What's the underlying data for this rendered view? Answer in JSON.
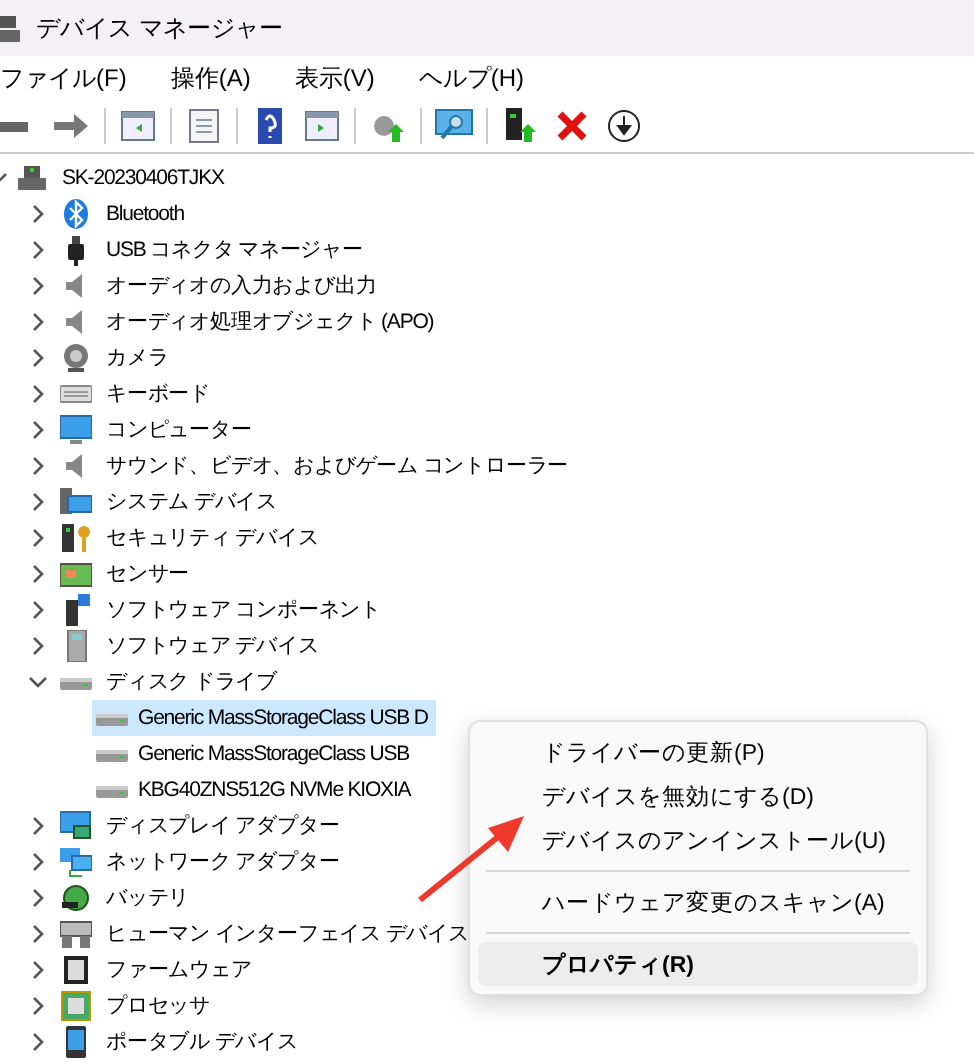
{
  "window": {
    "title": "デバイス マネージャー"
  },
  "menu_bar": [
    "ファイル(F)",
    "操作(A)",
    "表示(V)",
    "ヘルプ(H)"
  ],
  "tree": [
    {
      "label": "SK-20230406TJKX",
      "expanded": true,
      "children": [
        {
          "label": "Bluetooth",
          "expanded": false
        },
        {
          "label": "USB コネクタ マネージャー",
          "expanded": false
        },
        {
          "label": "オーディオの入力および出力",
          "expanded": false
        },
        {
          "label": "オーディオ処理オブジェクト (APO)",
          "expanded": false
        },
        {
          "label": "カメラ",
          "expanded": false
        },
        {
          "label": "キーボード",
          "expanded": false
        },
        {
          "label": "コンピューター",
          "expanded": false
        },
        {
          "label": "サウンド、ビデオ、およびゲーム コントローラー",
          "expanded": false
        },
        {
          "label": "システム デバイス",
          "expanded": false
        },
        {
          "label": "セキュリティ デバイス",
          "expanded": false
        },
        {
          "label": "センサー",
          "expanded": false
        },
        {
          "label": "ソフトウェア コンポーネント",
          "expanded": false
        },
        {
          "label": "ソフトウェア デバイス",
          "expanded": false
        },
        {
          "label": "ディスク ドライブ",
          "expanded": true,
          "children": [
            {
              "label": "Generic MassStorageClass USB D",
              "selected": true
            },
            {
              "label": "Generic MassStorageClass USB",
              "selected": false
            },
            {
              "label": "KBG40ZNS512G NVMe KIOXIA",
              "selected": false
            }
          ]
        },
        {
          "label": "ディスプレイ アダプター",
          "expanded": false
        },
        {
          "label": "ネットワーク アダプター",
          "expanded": false
        },
        {
          "label": "バッテリ",
          "expanded": false
        },
        {
          "label": "ヒューマン インターフェイス デバイス",
          "expanded": false
        },
        {
          "label": "ファームウェア",
          "expanded": false
        },
        {
          "label": "プロセッサ",
          "expanded": false
        },
        {
          "label": "ポータブル デバイス",
          "expanded": false
        }
      ]
    }
  ],
  "context_menu": [
    {
      "kind": "item",
      "label": "ドライバーの更新(P)",
      "selected": false,
      "bold": false
    },
    {
      "kind": "item",
      "label": "デバイスを無効にする(D)",
      "selected": false,
      "bold": false
    },
    {
      "kind": "item",
      "label": "デバイスのアンインストール(U)",
      "selected": false,
      "bold": false
    },
    {
      "kind": "separator"
    },
    {
      "kind": "item",
      "label": "ハードウェア変更のスキャン(A)",
      "selected": false,
      "bold": false
    },
    {
      "kind": "separator"
    },
    {
      "kind": "item",
      "label": "プロパティ(R)",
      "selected": true,
      "bold": true
    }
  ]
}
